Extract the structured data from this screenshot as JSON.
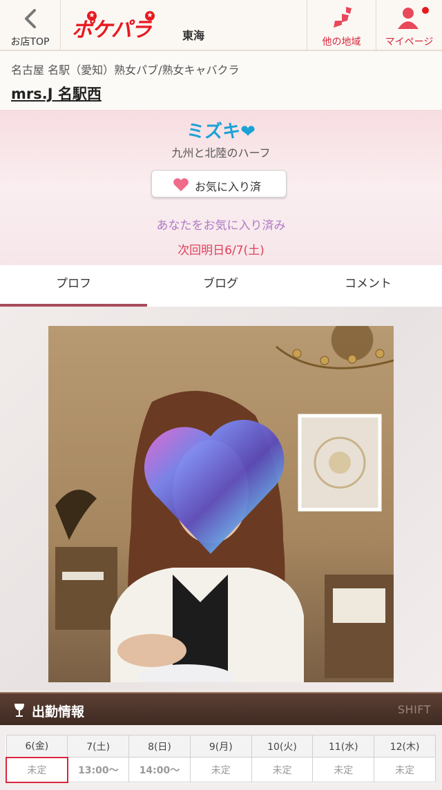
{
  "header": {
    "back_label": "お店TOP",
    "logo_text": "ポケパラ",
    "region": "東海",
    "other_regions_label": "他の地域",
    "mypage_label": "マイページ",
    "accent_color": "#e8191f"
  },
  "shop": {
    "breadcrumb": "名古屋 名駅（愛知）熟女パブ/熟女キャバクラ",
    "name": "mrs.J 名駅西"
  },
  "profile": {
    "name": "ミズキ❤",
    "catchphrase": "九州と北陸のハーフ",
    "favorite_button": "お気に入り済",
    "favorite_message": "あなたをお気に入り済み",
    "next_day": "次回明日6/7(土)"
  },
  "tabs": [
    {
      "label": "プロフ",
      "active": true
    },
    {
      "label": "ブログ",
      "active": false
    },
    {
      "label": "コメント",
      "active": false
    }
  ],
  "schedule": {
    "title": "出勤情報",
    "shift_label": "SHIFT",
    "days": [
      {
        "day": "6(金)",
        "time": "未定",
        "type": "weekday",
        "today": true
      },
      {
        "day": "7(土)",
        "time": "13:00〜",
        "type": "sat",
        "today": false
      },
      {
        "day": "8(日)",
        "time": "14:00〜",
        "type": "sun",
        "today": false
      },
      {
        "day": "9(月)",
        "time": "未定",
        "type": "weekday",
        "today": false
      },
      {
        "day": "10(火)",
        "time": "未定",
        "type": "weekday",
        "today": false
      },
      {
        "day": "11(水)",
        "time": "未定",
        "type": "weekday",
        "today": false
      },
      {
        "day": "12(木)",
        "time": "未定",
        "type": "weekday",
        "today": false
      }
    ]
  }
}
